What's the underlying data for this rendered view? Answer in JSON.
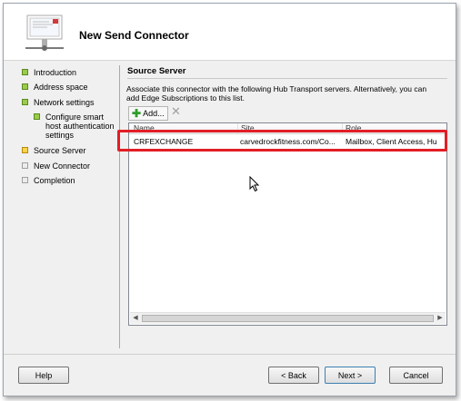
{
  "window": {
    "title": "New Send Connector"
  },
  "nav": {
    "items": [
      {
        "label": "Introduction",
        "state": "done"
      },
      {
        "label": "Address space",
        "state": "done"
      },
      {
        "label": "Network settings",
        "state": "done"
      },
      {
        "label": "Configure smart host authentication settings",
        "state": "done",
        "sub": true
      },
      {
        "label": "Source Server",
        "state": "current"
      },
      {
        "label": "New Connector",
        "state": "todo"
      },
      {
        "label": "Completion",
        "state": "todo"
      }
    ]
  },
  "content": {
    "section_title": "Source Server",
    "description": "Associate this connector with the following Hub Transport servers. Alternatively, you can add Edge Subscriptions to this list.",
    "toolbar": {
      "add_label": "Add...",
      "remove_icon": "close-icon"
    },
    "table": {
      "columns": [
        "Name",
        "Site",
        "Role"
      ],
      "rows": [
        {
          "name": "CRFEXCHANGE",
          "site": "carvedrockfitness.com/Co...",
          "role": "Mailbox, Client Access, Hu"
        }
      ]
    }
  },
  "footer": {
    "help_label": "Help",
    "back_label": "< Back",
    "next_label": "Next >",
    "cancel_label": "Cancel"
  },
  "colors": {
    "highlight": "#e21e26",
    "step_done": "#9bcb4a",
    "step_current": "#ffd34a",
    "step_todo": "#ececec"
  }
}
